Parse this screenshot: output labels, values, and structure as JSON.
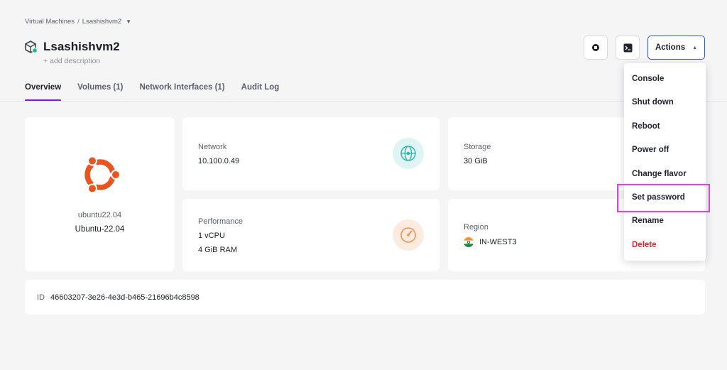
{
  "breadcrumb": {
    "parent": "Virtual Machines",
    "separator": "/",
    "current": "Lsashishvm2"
  },
  "header": {
    "title": "Lsashishvm2",
    "add_description": "+ add description",
    "actions_label": "Actions"
  },
  "tabs": [
    {
      "label": "Overview",
      "active": true
    },
    {
      "label": "Volumes (1)",
      "active": false
    },
    {
      "label": "Network Interfaces (1)",
      "active": false
    },
    {
      "label": "Audit Log",
      "active": false
    }
  ],
  "os": {
    "name": "ubuntu22.04",
    "version": "Ubuntu-22.04",
    "icon": "ubuntu-logo-icon",
    "color": "#e95420"
  },
  "network": {
    "label": "Network",
    "value": "10.100.0.49",
    "icon": "network-globe-icon"
  },
  "storage": {
    "label": "Storage",
    "value": "30 GiB"
  },
  "performance": {
    "label": "Performance",
    "cpu": "1 vCPU",
    "ram": "4 GiB RAM",
    "icon": "gauge-icon"
  },
  "region": {
    "label": "Region",
    "value": "IN-WEST3",
    "icon": "india-flag-icon"
  },
  "id_row": {
    "label": "ID",
    "value": "46603207-3e26-4e3d-b465-21696b4c8598"
  },
  "actions_menu": {
    "items": [
      {
        "label": "Console"
      },
      {
        "label": "Shut down"
      },
      {
        "label": "Reboot"
      },
      {
        "label": "Power off"
      },
      {
        "label": "Change flavor"
      },
      {
        "label": "Set password",
        "highlighted": true
      },
      {
        "label": "Rename"
      },
      {
        "label": "Delete",
        "danger": true
      }
    ]
  },
  "colors": {
    "accent": "#7a1fd6",
    "danger": "#e0252f",
    "highlight": "#e63ee6",
    "actions_border": "#3b5ab6"
  }
}
